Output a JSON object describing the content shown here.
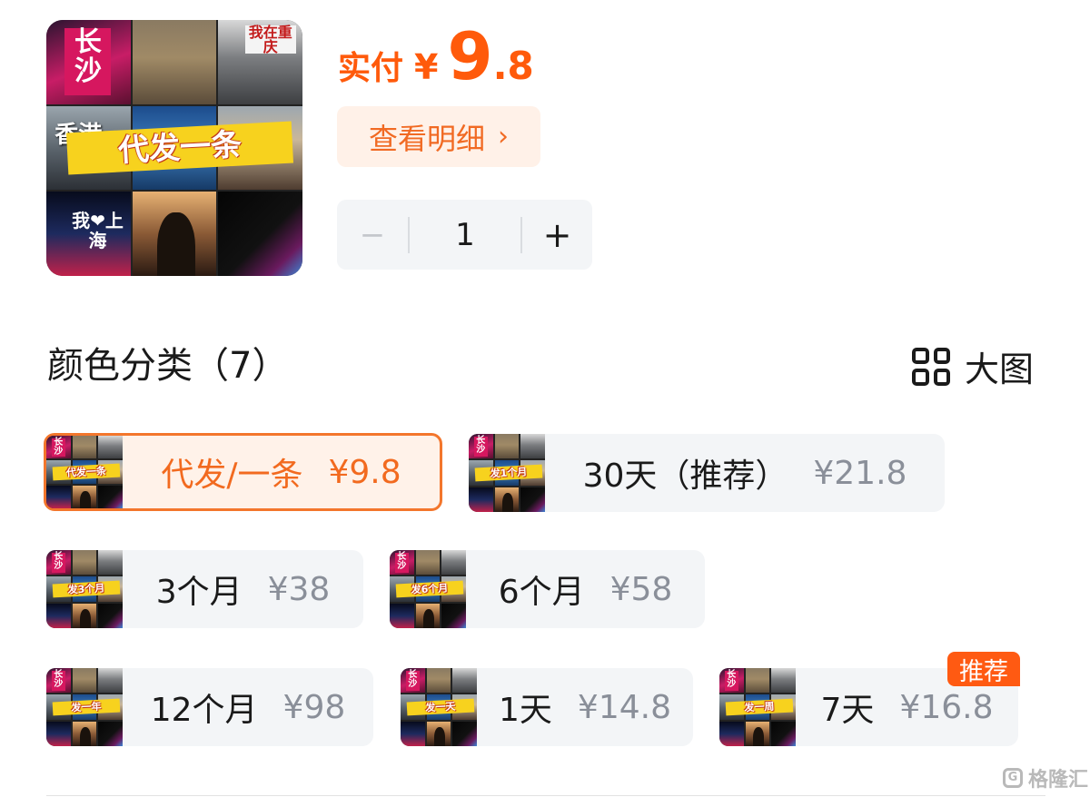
{
  "product": {
    "image": {
      "banner_text": "代发一条",
      "city_text_1": "长沙",
      "city_text_2": "我在重庆",
      "city_text_3": "香港",
      "city_text_4": "我❤上海"
    },
    "price_label": "实付",
    "currency": "¥",
    "price_integer": "9",
    "price_decimal": ".8",
    "detail_button_label": "查看明细",
    "quantity": "1",
    "minus_label": "−",
    "plus_label": "+"
  },
  "section": {
    "title": "颜色分类（7）",
    "big_view_label": "大图"
  },
  "options": [
    {
      "name": "代发/一条",
      "price": "¥9.8",
      "thumb_text": "代发一条",
      "selected": true
    },
    {
      "name": "30天（推荐）",
      "price": "¥21.8",
      "thumb_text": "发1个月"
    },
    {
      "name": "3个月",
      "price": "¥38",
      "thumb_text": "发3个月"
    },
    {
      "name": "6个月",
      "price": "¥58",
      "thumb_text": "发6个月"
    },
    {
      "name": "12个月",
      "price": "¥98",
      "thumb_text": "发一年"
    },
    {
      "name": "1天",
      "price": "¥14.8",
      "thumb_text": "发一天"
    },
    {
      "name": "7天",
      "price": "¥16.8",
      "thumb_text": "发一周",
      "badge": "推荐"
    }
  ],
  "watermark": "格隆汇",
  "colors": {
    "accent": "#ff5a0b",
    "selected_border": "#f3762c",
    "chip_bg": "#f3f5f7",
    "price_gray": "#8a8f99"
  }
}
